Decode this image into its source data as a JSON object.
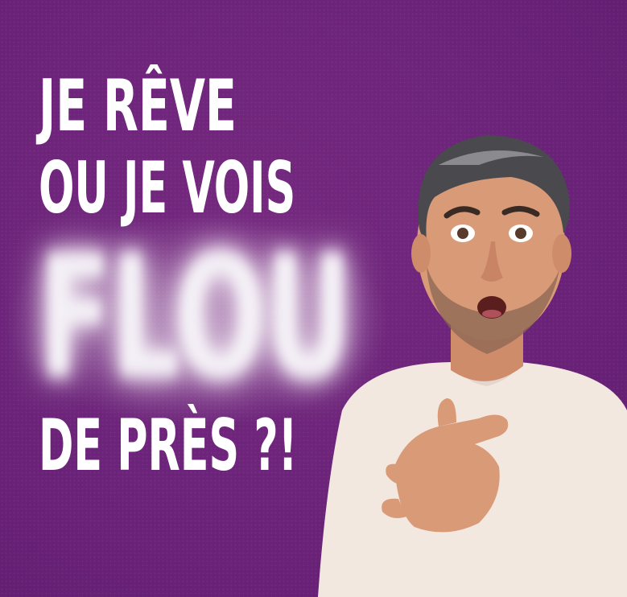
{
  "headline": {
    "line1": "JE RÊVE",
    "line2": "OU JE VOIS",
    "line3": "FLOU",
    "line4": "DE PRÈS ?!"
  },
  "colors": {
    "background": "#6a2278",
    "text": "#ffffff",
    "shirt": "#f2e8e0",
    "skin": "#d99a78"
  },
  "image": {
    "subject": "surprised-man-hand-on-chest"
  }
}
